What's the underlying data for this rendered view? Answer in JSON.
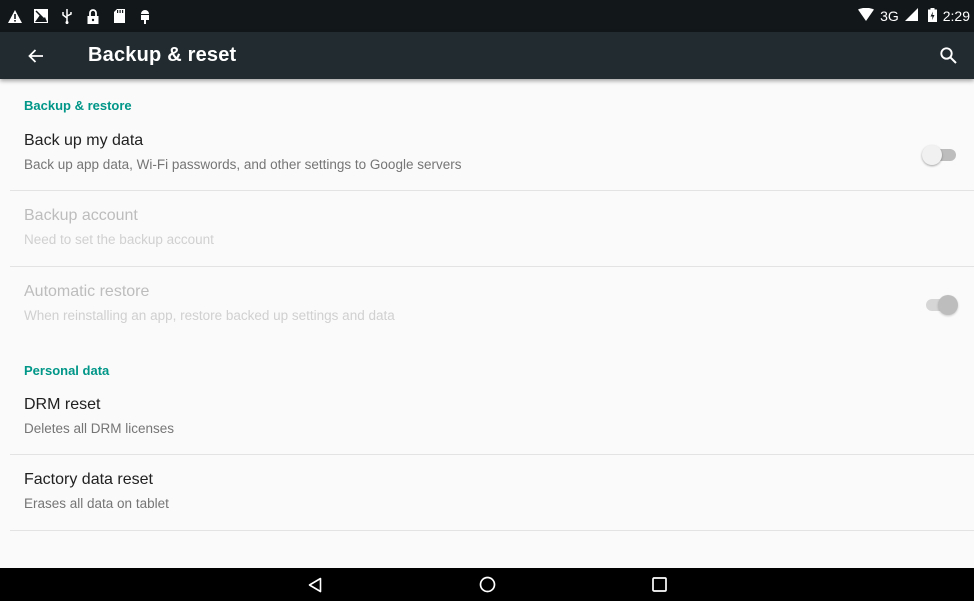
{
  "status_bar": {
    "icons_left": [
      "warning-icon",
      "image-notification-icon",
      "usb-icon",
      "lock-icon",
      "sd-card-icon",
      "android-debug-icon"
    ],
    "icons_right": [
      "wifi-icon",
      "cell-signal-icon",
      "battery-icon"
    ],
    "network": "3G",
    "time": "2:29"
  },
  "app_bar": {
    "title": "Backup & reset",
    "back_icon": "arrow-back-icon",
    "search_icon": "search-icon"
  },
  "sections": {
    "backup_restore": {
      "header": "Backup & restore",
      "items": [
        {
          "title": "Back up my data",
          "summary": "Back up app data, Wi-Fi passwords, and other settings to Google servers",
          "enabled": true,
          "toggle": "off"
        },
        {
          "title": "Backup account",
          "summary": "Need to set the backup account",
          "enabled": false
        },
        {
          "title": "Automatic restore",
          "summary": "When reinstalling an app, restore backed up settings and data",
          "enabled": false,
          "toggle": "on"
        }
      ]
    },
    "personal_data": {
      "header": "Personal data",
      "items": [
        {
          "title": "DRM reset",
          "summary": "Deletes all DRM licenses",
          "enabled": true
        },
        {
          "title": "Factory data reset",
          "summary": "Erases all data on tablet",
          "enabled": true
        }
      ]
    }
  },
  "nav_bar": {
    "buttons": [
      "back-triangle-icon",
      "home-circle-icon",
      "recents-square-icon"
    ]
  },
  "colors": {
    "status_bar": "#12171a",
    "app_bar": "#212b30",
    "accent": "#009688",
    "background": "#fafafa"
  }
}
